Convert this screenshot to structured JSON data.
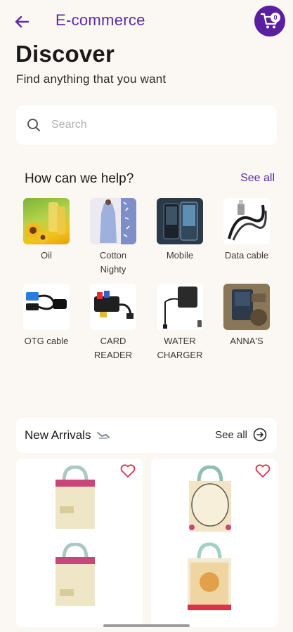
{
  "header": {
    "app_title": "E-commerce",
    "cart_count": "0"
  },
  "page": {
    "title": "Discover",
    "subtitle": "Find anything that you want"
  },
  "search": {
    "placeholder": "Search"
  },
  "help": {
    "title": "How can we help?",
    "see_all": "See all",
    "categories": [
      {
        "label": "Oil"
      },
      {
        "label": "Cotton\nNighty"
      },
      {
        "label": "Mobile"
      },
      {
        "label": "Data cable"
      },
      {
        "label": "OTG cable"
      },
      {
        "label": "CARD\nREADER"
      },
      {
        "label": "WATER\nCHARGER"
      },
      {
        "label": "ANNA'S"
      }
    ]
  },
  "arrivals": {
    "title": "New Arrivals",
    "see_all": "See all"
  },
  "colors": {
    "accent": "#5b2aa5",
    "cart_bg": "#5a1ea0",
    "heart": "#d9304a",
    "background": "#fbf7f2"
  }
}
